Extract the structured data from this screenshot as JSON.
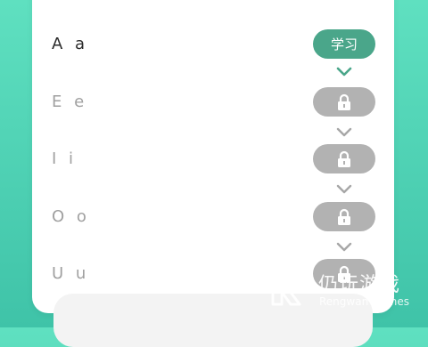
{
  "lessons": [
    {
      "letters": "A a",
      "state": "learn",
      "button_label": "学习",
      "icon": "none"
    },
    {
      "letters": "E e",
      "state": "locked",
      "button_label": "",
      "icon": "lock-icon"
    },
    {
      "letters": "I i",
      "state": "locked",
      "button_label": "",
      "icon": "lock-icon"
    },
    {
      "letters": "O o",
      "state": "locked",
      "button_label": "",
      "icon": "lock-icon"
    },
    {
      "letters": "U u",
      "state": "locked",
      "button_label": "",
      "icon": "lock-icon"
    }
  ],
  "colors": {
    "accent": "#4aa68a",
    "locked": "#b2b2b2",
    "chevron_active": "#4aa68a",
    "chevron_inactive": "#a7a7a7",
    "background_top": "#5fe0c0",
    "background_bottom": "#3fc3a8"
  },
  "watermark": {
    "title": "仍玩游戏",
    "subtitle": "Rengwan Games"
  }
}
